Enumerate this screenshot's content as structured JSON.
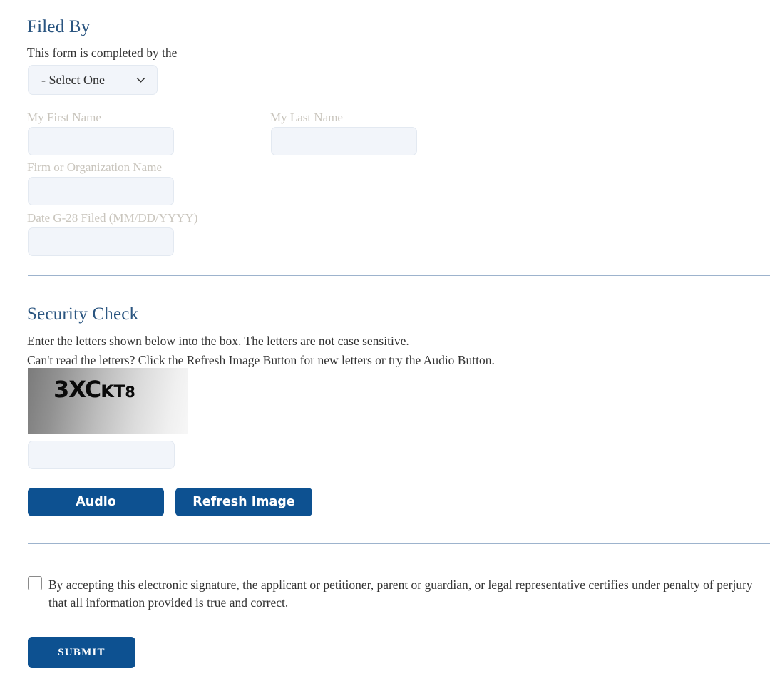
{
  "filed_by": {
    "heading": "Filed By",
    "intro": "This form is completed by the",
    "select": {
      "value": "- Select One",
      "icon": "chevron-down-icon",
      "options": [
        "- Select One"
      ]
    },
    "fields": [
      {
        "label": "My First Name",
        "value": "",
        "placeholder": ""
      },
      {
        "label": "My Last Name",
        "value": "",
        "placeholder": ""
      },
      {
        "label": "Firm or Organization Name",
        "value": "",
        "placeholder": ""
      },
      {
        "label": "Date G-28 Filed (MM/DD/YYYY)",
        "value": "",
        "placeholder": ""
      }
    ]
  },
  "security_check": {
    "heading": "Security Check",
    "line1": "Enter the letters shown below into the box. The letters are not case sensitive.",
    "line2": "Can't read the letters? Click the Refresh Image Button for new letters or try the Audio Button.",
    "captcha": {
      "text": "3XCKT8",
      "part1": "3XC",
      "part2": "KT",
      "part3": "8"
    },
    "answer_input": {
      "value": "",
      "placeholder": ""
    },
    "audio_button": "Audio",
    "refresh_button": "Refresh Image"
  },
  "signature": {
    "consent_text": "By accepting this electronic signature, the applicant or petitioner, parent or guardian, or legal representative certifies under penalty of perjury that all information provided is true and correct.",
    "checked": false,
    "submit_button": "SUBMIT"
  },
  "colors": {
    "heading_blue": "#2a5580",
    "button_blue": "#0d5191",
    "divider": "#9db3cd",
    "input_bg": "#f2f5fa",
    "label_gray": "#c9c5bd"
  }
}
